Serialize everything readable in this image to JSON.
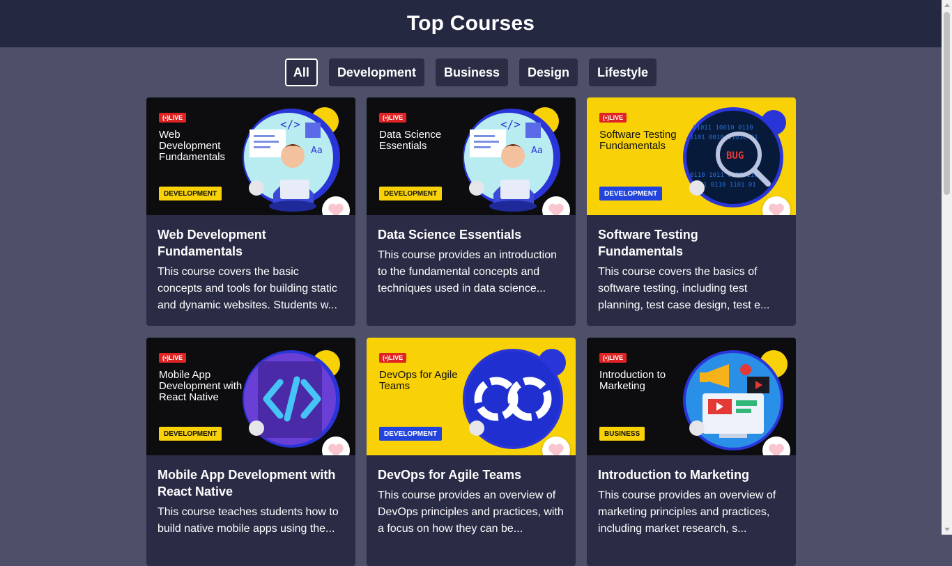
{
  "header": {
    "title": "Top Courses"
  },
  "filters": [
    {
      "label": "All",
      "active": true
    },
    {
      "label": "Development",
      "active": false
    },
    {
      "label": "Business",
      "active": false
    },
    {
      "label": "Design",
      "active": false
    },
    {
      "label": "Lifestyle",
      "active": false
    }
  ],
  "courses": [
    {
      "thumb_theme": "dark",
      "live_label": "LIVE",
      "thumb_title": "Web Development Fundamentals",
      "tag": "DEVELOPMENT",
      "art": "developer-illustration",
      "title": "Web Development Fundamentals",
      "description": "This course covers the basic concepts and tools for building static and dynamic websites. Students w..."
    },
    {
      "thumb_theme": "dark",
      "live_label": "LIVE",
      "thumb_title": "Data Science Essentials",
      "tag": "DEVELOPMENT",
      "art": "developer-illustration",
      "title": "Data Science Essentials",
      "description": "This course provides an introduction to the fundamental concepts and techniques used in data science..."
    },
    {
      "thumb_theme": "yellow",
      "live_label": "LIVE",
      "thumb_title": "Software Testing Fundamentals",
      "tag": "DEVELOPMENT",
      "art": "bug-magnifier-illustration",
      "art_text": "BUG",
      "title": "Software Testing Fundamentals",
      "description": "This course covers the basics of software testing, including test planning, test case design, test e..."
    },
    {
      "thumb_theme": "dark",
      "live_label": "LIVE",
      "thumb_title": "Mobile App Development with React Native",
      "tag": "DEVELOPMENT",
      "art": "code-brackets-illustration",
      "title": "Mobile App Development with React Native",
      "description": "This course teaches students how to build native mobile apps using the..."
    },
    {
      "thumb_theme": "yellow",
      "live_label": "LIVE",
      "thumb_title": "DevOps for Agile Teams",
      "tag": "DEVELOPMENT",
      "art": "devops-infinity-illustration",
      "title": "DevOps for Agile Teams",
      "description": "This course provides an overview of DevOps principles and practices, with a focus on how they can be..."
    },
    {
      "thumb_theme": "dark",
      "live_label": "LIVE",
      "thumb_title": "Introduction to Marketing",
      "tag": "BUSINESS",
      "art": "marketing-megaphone-illustration",
      "title": "Introduction to Marketing",
      "description": "This course provides an overview of marketing principles and practices, including market research, s..."
    }
  ],
  "icons": {
    "favorite": "heart-icon",
    "live": "broadcast-icon"
  },
  "colors": {
    "header_bg": "#252841",
    "page_bg": "#4d5068",
    "card_bg": "#2a2c45",
    "accent_yellow": "#f8d107",
    "accent_blue": "#2244dd",
    "live_red": "#e02424",
    "heart_pink": "#f9c5cf"
  }
}
